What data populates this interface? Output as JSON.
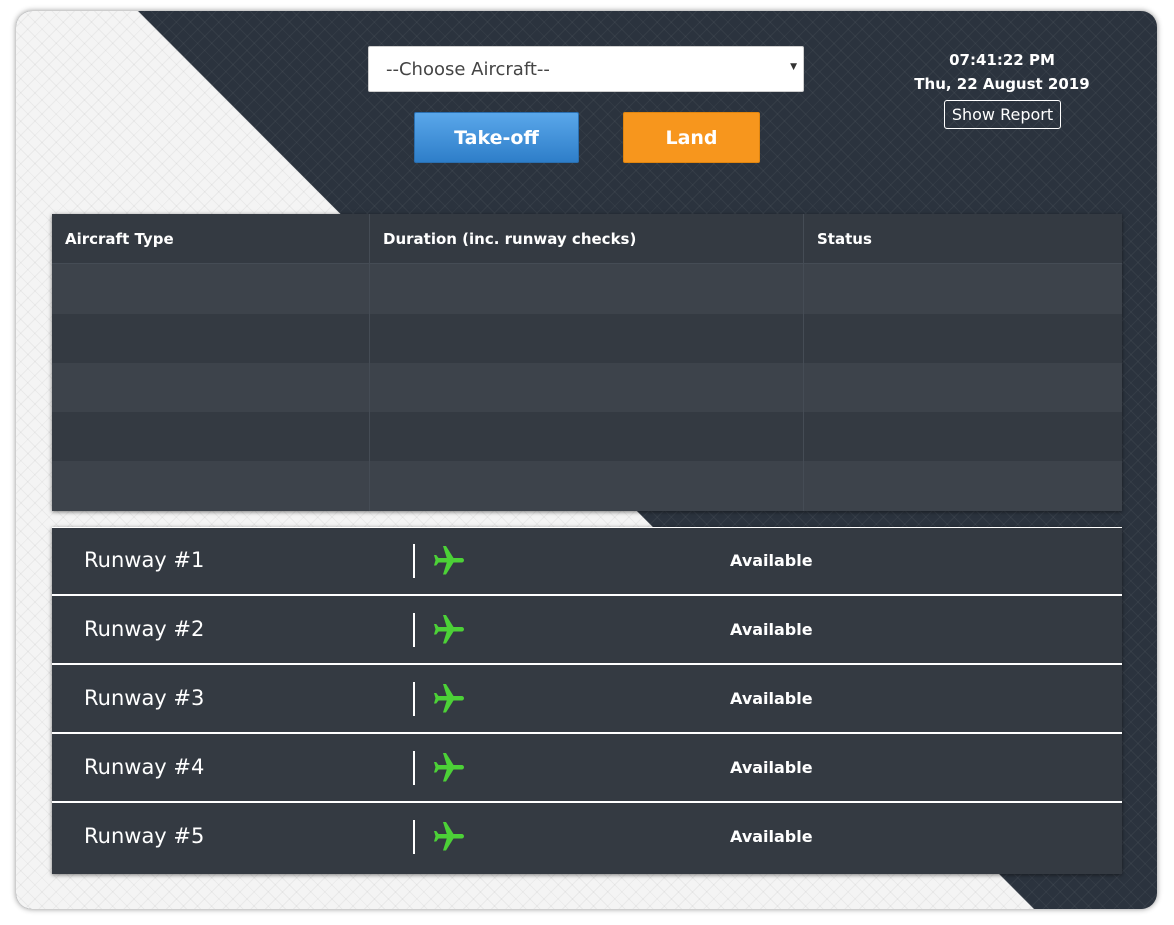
{
  "controls": {
    "aircraft_select": "--Choose Aircraft--",
    "takeoff_label": "Take-off",
    "land_label": "Land"
  },
  "clock": {
    "time": "07:41:22 PM",
    "date": "Thu, 22 August 2019",
    "report_label": "Show Report"
  },
  "table": {
    "headers": [
      "Aircraft Type",
      "Duration (inc. runway checks)",
      "Status"
    ],
    "rows": [
      [
        "",
        "",
        ""
      ],
      [
        "",
        "",
        ""
      ],
      [
        "",
        "",
        ""
      ],
      [
        "",
        "",
        ""
      ],
      [
        "",
        "",
        ""
      ]
    ]
  },
  "runways": [
    {
      "name": "Runway #1",
      "icon": "airplane-icon",
      "status": "Available"
    },
    {
      "name": "Runway #2",
      "icon": "airplane-icon",
      "status": "Available"
    },
    {
      "name": "Runway #3",
      "icon": "airplane-icon",
      "status": "Available"
    },
    {
      "name": "Runway #4",
      "icon": "airplane-icon",
      "status": "Available"
    },
    {
      "name": "Runway #5",
      "icon": "airplane-icon",
      "status": "Available"
    }
  ],
  "colors": {
    "panel": "#343a42",
    "takeoff": "#3d8fd9",
    "land": "#f7961d",
    "available_icon": "#4cd137"
  }
}
